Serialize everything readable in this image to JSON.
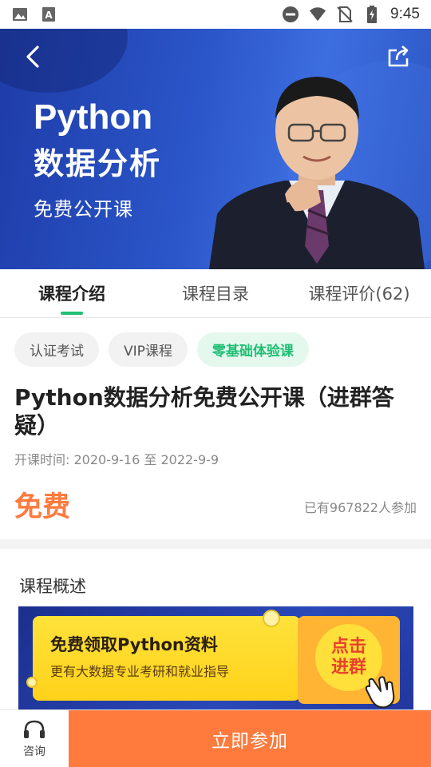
{
  "status_bar": {
    "time": "9:45",
    "icons": [
      "image-icon",
      "text-a-icon",
      "dnd-icon",
      "wifi-icon",
      "no-sim-icon",
      "battery-charging-icon"
    ]
  },
  "banner": {
    "title_line1": "Python",
    "title_line2": "数据分析",
    "subtitle": "免费公开课",
    "back_icon": "chevron-left-icon",
    "share_icon": "share-icon",
    "bg_color": "#2b56c9"
  },
  "tabs": [
    {
      "label": "课程介绍",
      "active": true
    },
    {
      "label": "课程目录",
      "active": false
    },
    {
      "label": "课程评价(62)",
      "active": false
    }
  ],
  "tags": [
    "认证考试",
    "VIP课程",
    "零基础体验课"
  ],
  "course": {
    "title": "Python数据分析免费公开课（进群答疑）",
    "time": "开课时间: 2020-9-16 至 2022-9-9",
    "price": "免费",
    "participants": "已有967822人参加"
  },
  "overview": {
    "title": "课程概述",
    "promo_main": "免费领取Python资料",
    "promo_sub": "更有大数据专业考研和就业指导",
    "promo_button_line1": "点击",
    "promo_button_line2": "进群"
  },
  "bottom_bar": {
    "consult_label": "咨询",
    "join_label": "立即参加"
  },
  "colors": {
    "accent_green": "#1fbf73",
    "accent_orange": "#ff7a3d"
  }
}
